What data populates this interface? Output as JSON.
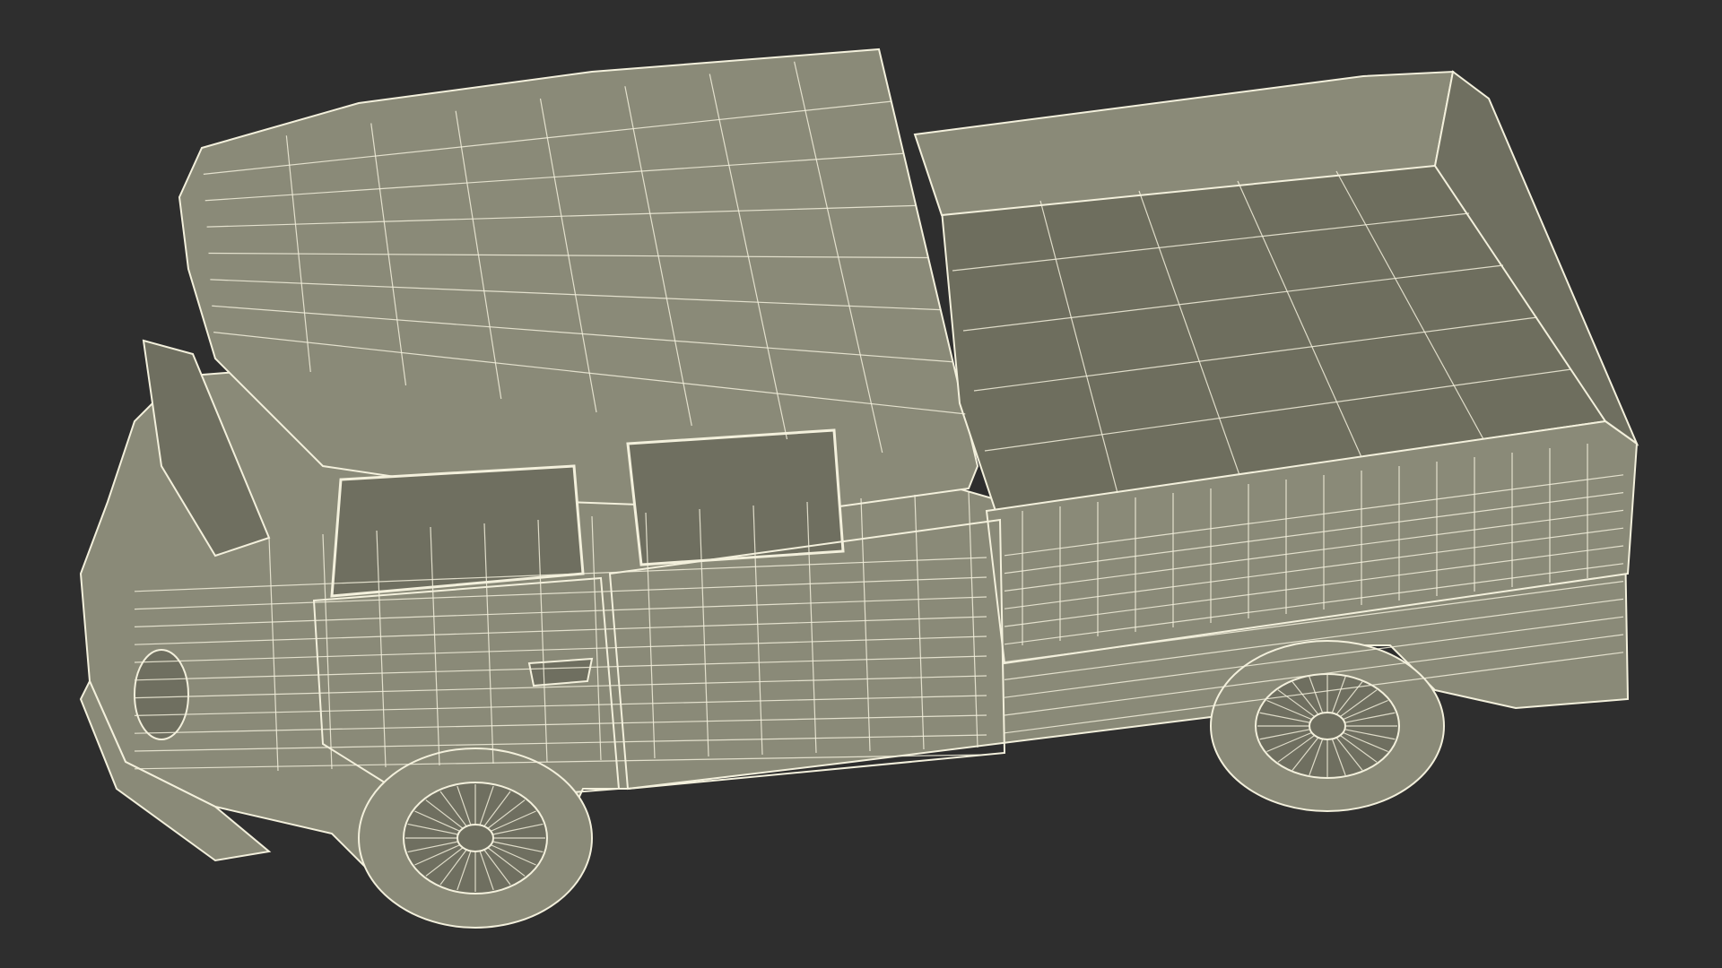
{
  "scene": {
    "subject": "wireframe-pickup-truck",
    "colors": {
      "background": "#2e2e2e",
      "body_fill": "#8a8a78",
      "body_fill_dark": "#6f6f60",
      "bed_floor": "#6e6e5e",
      "wire": "#f3f0dc",
      "outline": "#d9d6bf"
    }
  }
}
